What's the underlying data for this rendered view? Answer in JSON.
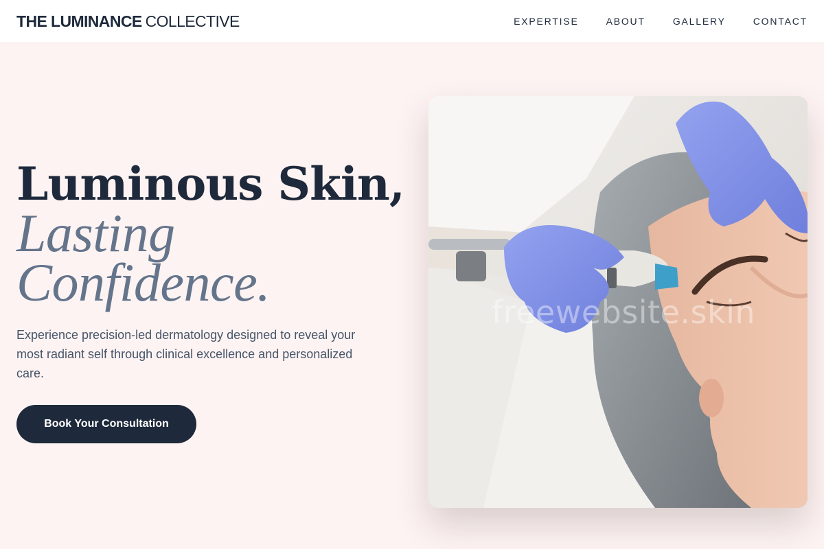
{
  "brand": {
    "bold": "THE LUMINANCE",
    "light": "COLLECTIVE"
  },
  "nav": {
    "items": [
      "EXPERTISE",
      "ABOUT",
      "GALLERY",
      "CONTACT"
    ]
  },
  "hero": {
    "title_line1": "Luminous Skin,",
    "title_line2": "Lasting",
    "title_line3": "Confidence.",
    "description": "Experience precision-led dermatology designed to reveal your most radiant self through clinical excellence and personalized care.",
    "cta_label": "Book Your Consultation"
  },
  "photo": {
    "watermark": "freewebsite.skin"
  },
  "colors": {
    "page_bg": "#fdf3f2",
    "navy": "#1e293b",
    "slate": "#64748b",
    "glove_blue": "#7d8fe6"
  }
}
